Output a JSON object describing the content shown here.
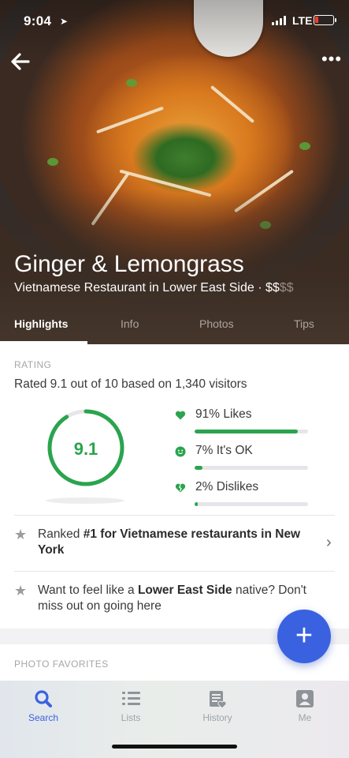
{
  "status_bar": {
    "time": "9:04",
    "network": "LTE"
  },
  "hero": {
    "title": "Ginger & Lemongrass",
    "subtitle_main": "Vietnamese Restaurant in Lower East Side · ",
    "price_active": "$$",
    "price_inactive": "$$"
  },
  "tabs": [
    {
      "label": "Highlights",
      "active": true
    },
    {
      "label": "Info",
      "active": false
    },
    {
      "label": "Photos",
      "active": false
    },
    {
      "label": "Tips",
      "active": false
    }
  ],
  "rating": {
    "section_label": "RATING",
    "summary": "Rated 9.1 out of 10 based on 1,340 visitors",
    "score": "9.1",
    "score_fraction": 0.91,
    "stats": [
      {
        "label": "91% Likes",
        "fraction": 0.91,
        "icon": "heart-icon"
      },
      {
        "label": "7% It's OK",
        "fraction": 0.07,
        "icon": "smiley-icon"
      },
      {
        "label": "2% Dislikes",
        "fraction": 0.02,
        "icon": "broken-heart-icon"
      }
    ]
  },
  "ranked": {
    "prefix": "Ranked ",
    "bold": "#1 for Vietnamese restaurants in New York"
  },
  "native": {
    "prefix": "Want to feel like a ",
    "bold": "Lower East Side",
    "suffix": " native? Don't miss out on going here"
  },
  "photo_favorites": {
    "section_label": "PHOTO FAVORITES"
  },
  "fab": {
    "label": "+"
  },
  "bottom_nav": [
    {
      "label": "Search",
      "icon": "search-icon",
      "active": true
    },
    {
      "label": "Lists",
      "icon": "list-icon",
      "active": false
    },
    {
      "label": "History",
      "icon": "history-icon",
      "active": false
    },
    {
      "label": "Me",
      "icon": "profile-icon",
      "active": false
    }
  ],
  "colors": {
    "accent_green": "#2aa44d",
    "accent_blue": "#3a62e0",
    "battery_low": "#ff3b30"
  }
}
